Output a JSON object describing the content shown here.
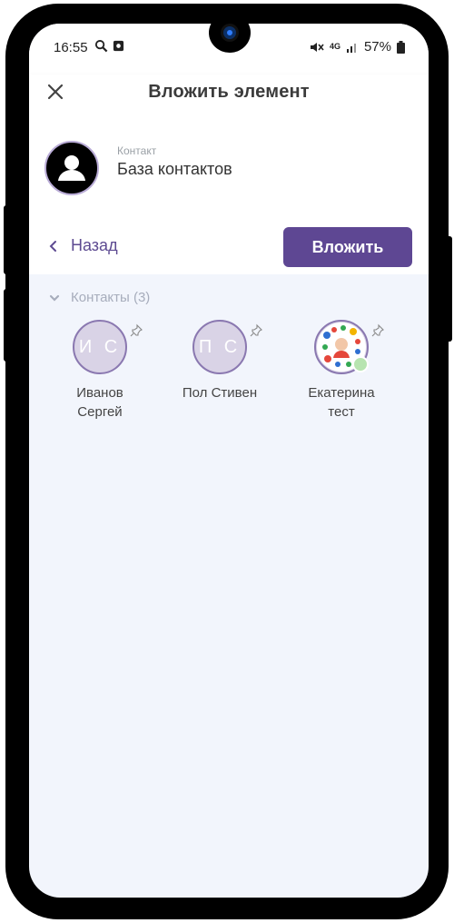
{
  "status_bar": {
    "time": "16:55",
    "network": "4G",
    "battery": "57%"
  },
  "header": {
    "title": "Вложить элемент"
  },
  "contact_card": {
    "caption": "Контакт",
    "name": "База контактов"
  },
  "actions": {
    "back_label": "Назад",
    "attach_label": "Вложить"
  },
  "contacts": {
    "section_label": "Контакты (3)",
    "items": [
      {
        "initials": "И С",
        "name_line1": "Иванов",
        "name_line2": "Сергей"
      },
      {
        "initials": "П С",
        "name_line1": "Пол Стивен",
        "name_line2": ""
      },
      {
        "initials": "",
        "name_line1": "Екатерина",
        "name_line2": "тест"
      }
    ]
  },
  "colors": {
    "accent": "#5e4793",
    "link": "#5d4a91",
    "avatar_bg": "#d9d3e6",
    "list_bg": "#f2f5fc",
    "online": "#b7e4b0"
  },
  "icons": {
    "close": "close-icon",
    "back": "chevron-left-icon",
    "section_toggle": "chevron-down-icon",
    "pin": "pin-icon",
    "contact_avatar": "person-icon"
  }
}
